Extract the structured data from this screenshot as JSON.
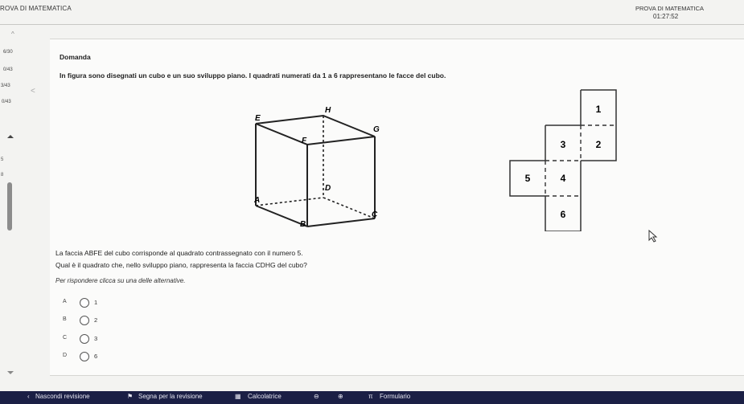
{
  "header": {
    "app_title": "ROVA DI MATEMATICA",
    "test_name": "PROVA DI MATEMATICA",
    "timer": "01:27:52"
  },
  "side_panel": {
    "scores": [
      "6/30",
      "0/43",
      "3/43",
      "0/43"
    ],
    "marks": [
      "5",
      "8"
    ]
  },
  "question": {
    "heading": "Domanda",
    "statement": "In figura sono disegnati un cubo e un suo sviluppo piano. I quadrati numerati da 1 a 6 rappresentano le facce del cubo.",
    "line1": "La faccia ABFE del cubo corrisponde al quadrato contrassegnato con il numero 5.",
    "line2": "Qual è il quadrato che, nello sviluppo piano, rappresenta la faccia CDHG del cubo?",
    "instruction": "Per rispondere clicca su una delle alternative.",
    "options": [
      {
        "letter": "A",
        "value": "1"
      },
      {
        "letter": "B",
        "value": "2"
      },
      {
        "letter": "C",
        "value": "3"
      },
      {
        "letter": "D",
        "value": "6"
      }
    ]
  },
  "cube": {
    "vertices": [
      "H",
      "E",
      "G",
      "F",
      "D",
      "A",
      "C",
      "B"
    ]
  },
  "net": {
    "faces": [
      "1",
      "3",
      "2",
      "5",
      "4",
      "6"
    ]
  },
  "bottom_bar": {
    "hide_review": "Nascondi revisione",
    "mark_review": "Segna per la revisione",
    "calculator": "Calcolatrice",
    "formulary": "Formulario",
    "pi_symbol": "π"
  }
}
